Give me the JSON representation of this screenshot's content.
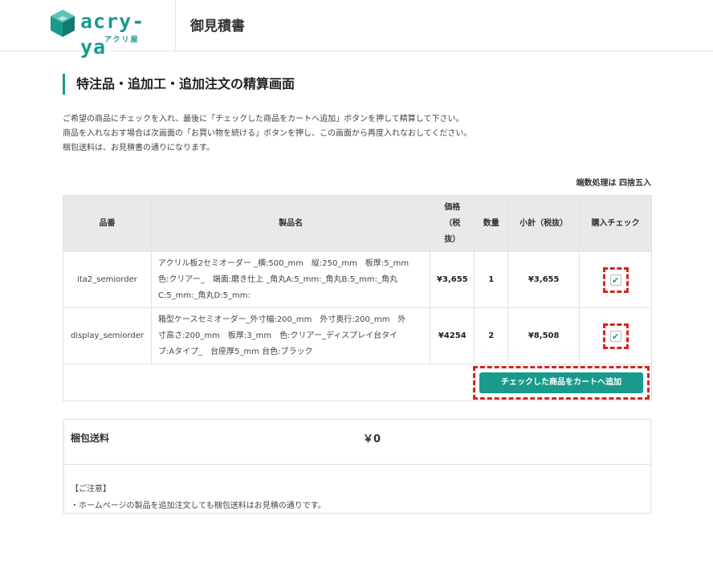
{
  "header": {
    "logo_text": "acry-ya",
    "logo_sub": "アクリ屋",
    "title": "御見積書"
  },
  "page": {
    "title": "特注品・追加工・追加注文の精算画面",
    "description": [
      "ご希望の商品にチェックを入れ、最後に「チェックした商品をカートへ追加」ボタンを押して精算して下さい。",
      "商品を入れなおす場合は次画面の「お買い物を続ける」ボタンを押し、この画面から再度入れなおしてください。",
      "梱包送料は、お見積書の通りになります。"
    ],
    "rounding_note": "端数処理は 四捨五入"
  },
  "table": {
    "headers": {
      "code": "品番",
      "name": "製品名",
      "price_1": "価格",
      "price_2": "（税",
      "price_3": "抜）",
      "qty": "数量",
      "subtotal": "小計（税抜）",
      "check": "購入チェック"
    },
    "rows": [
      {
        "code": "ita2_semiorder",
        "name_1": "アクリル板2セミオーダー _横:500_mm　縦:250_mm　板厚:5_mm",
        "name_2": "色:クリアー_　端面:磨き仕上 _角丸A:5_mm:_角丸B:5_mm:_角丸",
        "name_3": "C:5_mm:_角丸D:5_mm:",
        "price": "¥3,655",
        "qty": "1",
        "subtotal": "¥3,655",
        "checked": true,
        "check_mark": "✔"
      },
      {
        "code": "display_semiorder",
        "name_1": "箱型ケースセミオーダー_外寸幅:200_mm　外寸奥行:200_mm　外",
        "name_2": "寸高さ:200_mm　板厚:3_mm　色:クリアー_ディスプレイ台タイ",
        "name_3": "プ:Aタイプ_　台座厚5_mm 台色:ブラック",
        "price": "¥4254",
        "qty": "2",
        "subtotal": "¥8,508",
        "checked": true,
        "check_mark": "✔"
      }
    ],
    "cart_button_label": "チェックした商品をカートへ追加"
  },
  "shipping": {
    "label": "梱包送料",
    "value": "￥0",
    "notice_title": "【ご注意】",
    "notice_text": "・ホームページの製品を追加注文しても梱包送料はお見積の通りです。"
  },
  "colors": {
    "accent": "#1a9a8c",
    "highlight": "#d9241b",
    "header_bg": "#e9e9e9"
  }
}
